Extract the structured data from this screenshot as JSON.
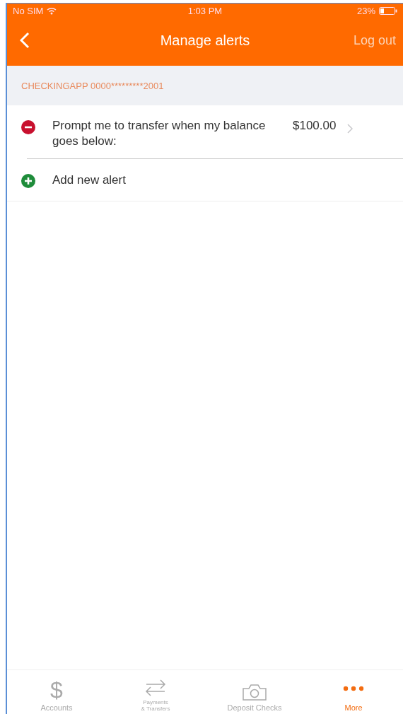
{
  "status_bar": {
    "carrier": "No SIM",
    "time": "1:03 PM",
    "battery": "23%"
  },
  "nav_bar": {
    "back": true,
    "title": "Manage alerts",
    "action": "Log out"
  },
  "section": {
    "header": "CHECKINGAPP 0000*********2001"
  },
  "alerts": [
    {
      "kind": "remove",
      "text": "Prompt me to transfer when my balance goes below:",
      "value": "$100.00",
      "chevron": true
    },
    {
      "kind": "add",
      "text": "Add new alert",
      "chevron": false
    }
  ],
  "tab_bar": [
    {
      "kind": "dollar",
      "glyph": "$",
      "label": "Accounts",
      "selected": false
    },
    {
      "kind": "transfer",
      "label": "Payments\n& Transfers",
      "selected": false
    },
    {
      "kind": "camera",
      "label": "Deposit Checks",
      "selected": false
    },
    {
      "kind": "more",
      "label": "More",
      "selected": true
    }
  ]
}
